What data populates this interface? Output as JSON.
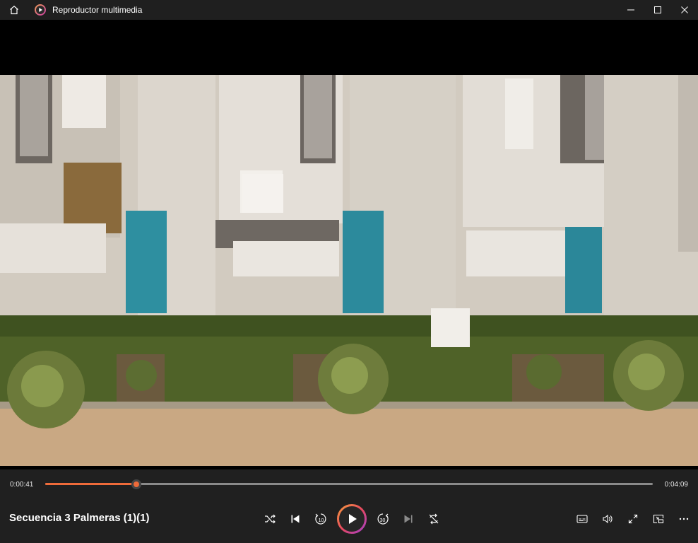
{
  "window": {
    "title": "Reproductor multimedia"
  },
  "player": {
    "current_time": "0:00:41",
    "total_time": "0:04:09",
    "progress": 0.1498,
    "media_title": "Secuencia 3 Palmeras (1)(1)",
    "skip_back_label": "10",
    "skip_forward_label": "30"
  },
  "colors": {
    "accent": "#ef6b3a",
    "titlebar": "#1f1f1f",
    "controls_bg": "#202020"
  },
  "icons": {
    "home": "home-icon",
    "app": "media-player-icon",
    "shuffle": "shuffle-icon",
    "previous": "previous-icon",
    "skip_back": "skip-back-10-icon",
    "play": "play-icon",
    "skip_forward": "skip-forward-30-icon",
    "next": "next-icon",
    "repeat": "repeat-off-icon",
    "subtitles": "subtitles-icon",
    "volume": "volume-icon",
    "fullscreen": "fullscreen-icon",
    "miniplayer": "mini-player-icon",
    "more": "more-icon"
  }
}
